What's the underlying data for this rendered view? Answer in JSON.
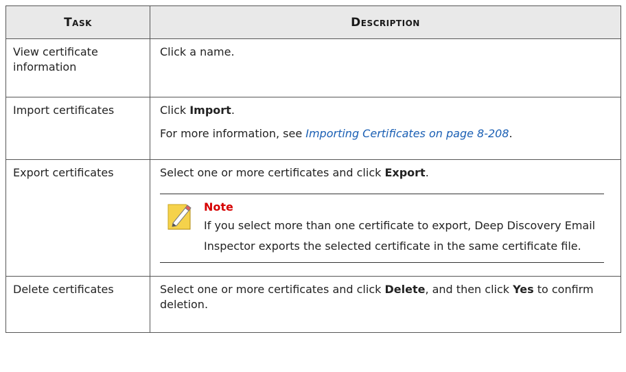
{
  "table": {
    "headers": {
      "task": "Task",
      "description": "Description"
    },
    "rows": [
      {
        "task": "View certificate information",
        "description": "Click a name."
      },
      {
        "task": "Import certificates",
        "desc_prefix": "Click ",
        "desc_bold": "Import",
        "desc_suffix": ".",
        "more_prefix": "For more information, see ",
        "more_link": "Importing Certificates on page 8-208",
        "more_suffix": "."
      },
      {
        "task": "Export certificates",
        "desc_prefix": "Select one or more certificates and click ",
        "desc_bold": "Export",
        "desc_suffix": ".",
        "note_title": "Note",
        "note_text": "If you select more than one certificate to export, Deep Discovery Email Inspector exports the selected certificate in the same certificate file.",
        "note_icon": "note-pencil-icon"
      },
      {
        "task": "Delete certificates",
        "desc_part1": "Select one or more certificates and click ",
        "desc_bold1": "Delete",
        "desc_part2": ", and then click ",
        "desc_bold2": "Yes",
        "desc_part3": " to confirm deletion."
      }
    ]
  },
  "colors": {
    "header_bg": "#e9e9e9",
    "border": "#555555",
    "link": "#1a5fb4",
    "note_title": "#d60000",
    "note_icon_fill": "#f5d24b"
  }
}
